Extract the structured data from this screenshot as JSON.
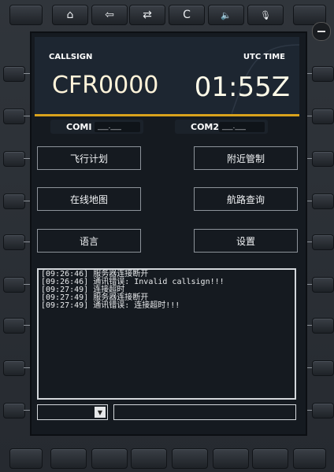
{
  "toolbar": {
    "home_icon": "⌂",
    "back_icon": "⇦",
    "swap_icon": "⇄",
    "clear_label": "C",
    "sound_icon": "🔈",
    "mic_icon": "🎙"
  },
  "header": {
    "callsign_label": "CALLSIGN",
    "callsign_value": "CFR0000",
    "utc_label": "UTC TIME",
    "utc_value": "01:55Z"
  },
  "com": {
    "com1_label": "COMI",
    "com1_value": "___.___",
    "com2_label": "COM2",
    "com2_value": "___.___"
  },
  "menu": {
    "flight_plan": "飞行计划",
    "nearby_control": "附近管制",
    "online_map": "在线地图",
    "route_query": "航路查询",
    "language": "语言",
    "settings": "设置"
  },
  "log": [
    "[09:26:46] 服务器连接断开",
    "[09:26:46] 通讯错误: Invalid callsign!!!",
    "[09:27:49] 连接超时",
    "[09:27:49] 服务器连接断开",
    "[09:27:49] 通讯错误: 连接超时!!!"
  ],
  "input": {
    "select_value": "",
    "message_value": ""
  },
  "colors": {
    "accent": "#d9a21c",
    "header_bg": "#1d2631",
    "screen_bg": "#151a20"
  }
}
